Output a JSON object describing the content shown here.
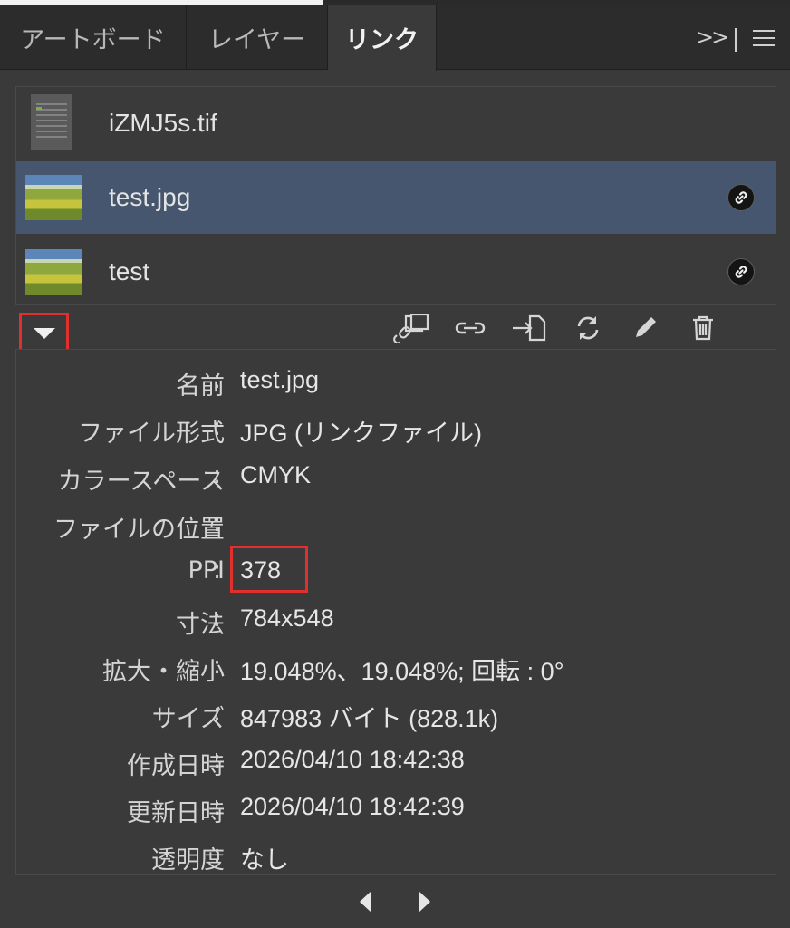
{
  "tabs": [
    {
      "label": "アートボード",
      "active": false
    },
    {
      "label": "レイヤー",
      "active": false
    },
    {
      "label": "リンク",
      "active": true
    }
  ],
  "tab_overflow": ">>",
  "links": [
    {
      "name": "iZMJ5s.tif",
      "thumb": "tif-screenshot",
      "linked": false,
      "selected": false
    },
    {
      "name": "test.jpg",
      "thumb": "jpg-landscape",
      "linked": true,
      "selected": true
    },
    {
      "name": "test",
      "thumb": "jpg-landscape",
      "linked": true,
      "selected": false
    }
  ],
  "toolbar_icons": [
    "relink-from-library-icon",
    "relink-icon",
    "go-to-link-icon",
    "update-link-icon",
    "edit-original-icon",
    "delete-icon"
  ],
  "info": [
    {
      "label": "名前",
      "value": "test.jpg"
    },
    {
      "label": "ファイル形式",
      "value": "JPG (リンクファイル)"
    },
    {
      "label": "カラースペース",
      "value": "CMYK"
    },
    {
      "label": "ファイルの位置",
      "value": ""
    },
    {
      "label": "PPI",
      "value": "378"
    },
    {
      "label": "寸法",
      "value": "784x548"
    },
    {
      "label": "拡大・縮小",
      "value": "19.048%、19.048%; 回転 : 0°"
    },
    {
      "label": "サイズ",
      "value": "847983 バイト (828.1k)"
    },
    {
      "label": "作成日時",
      "value": "2026/04/10 18:42:38"
    },
    {
      "label": "更新日時",
      "value": "2026/04/10 18:42:39"
    },
    {
      "label": "透明度",
      "value": "なし"
    }
  ],
  "colors": {
    "highlight": "#e0302e",
    "selected_row": "#45566e",
    "panel": "#3a3a3a"
  }
}
